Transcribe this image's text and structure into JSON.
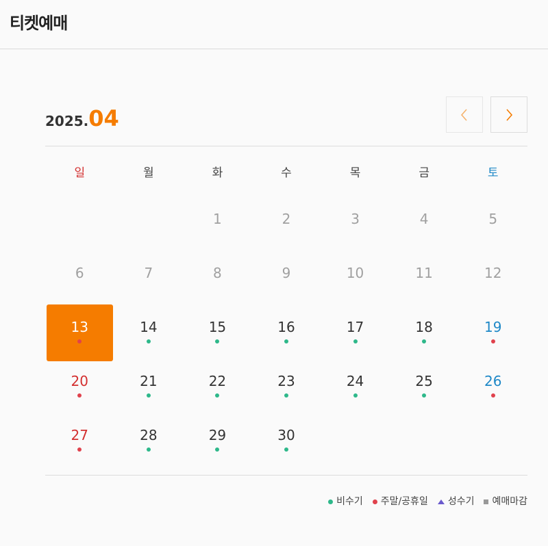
{
  "header": {
    "title": "티켓예매"
  },
  "calendar": {
    "year": "2025.",
    "month": "04",
    "weekdays": [
      "일",
      "월",
      "화",
      "수",
      "목",
      "금",
      "토"
    ],
    "colors": {
      "accent": "#f57c00",
      "sunday": "#d32f2f",
      "saturday": "#1e88c7",
      "off_peak": "#2eb88a",
      "holiday": "#e0424d",
      "peak": "#6a5acd",
      "closed": "#999999"
    },
    "days": [
      {
        "d": "",
        "col": 0
      },
      {
        "d": "",
        "col": 1
      },
      {
        "d": "1",
        "state": "past"
      },
      {
        "d": "2",
        "state": "past"
      },
      {
        "d": "3",
        "state": "past"
      },
      {
        "d": "4",
        "state": "past"
      },
      {
        "d": "5",
        "state": "past"
      },
      {
        "d": "6",
        "state": "past"
      },
      {
        "d": "7",
        "state": "past"
      },
      {
        "d": "8",
        "state": "past"
      },
      {
        "d": "9",
        "state": "past"
      },
      {
        "d": "10",
        "state": "past"
      },
      {
        "d": "11",
        "state": "past"
      },
      {
        "d": "12",
        "state": "past"
      },
      {
        "d": "13",
        "state": "selected",
        "dot": "hol"
      },
      {
        "d": "14",
        "dot": "off"
      },
      {
        "d": "15",
        "dot": "off"
      },
      {
        "d": "16",
        "dot": "off"
      },
      {
        "d": "17",
        "dot": "off"
      },
      {
        "d": "18",
        "dot": "off"
      },
      {
        "d": "19",
        "dot": "hol"
      },
      {
        "d": "20",
        "dot": "hol"
      },
      {
        "d": "21",
        "dot": "off"
      },
      {
        "d": "22",
        "dot": "off"
      },
      {
        "d": "23",
        "dot": "off"
      },
      {
        "d": "24",
        "dot": "off"
      },
      {
        "d": "25",
        "dot": "off"
      },
      {
        "d": "26",
        "dot": "hol"
      },
      {
        "d": "27",
        "dot": "hol"
      },
      {
        "d": "28",
        "dot": "off"
      },
      {
        "d": "29",
        "dot": "off"
      },
      {
        "d": "30",
        "dot": "off"
      }
    ]
  },
  "legend": {
    "off_peak": "비수기",
    "holiday": "주말/공휴일",
    "peak": "성수기",
    "closed": "예매마감"
  },
  "nav": {
    "prev_icon": "chevron-left-icon",
    "next_icon": "chevron-right-icon"
  }
}
